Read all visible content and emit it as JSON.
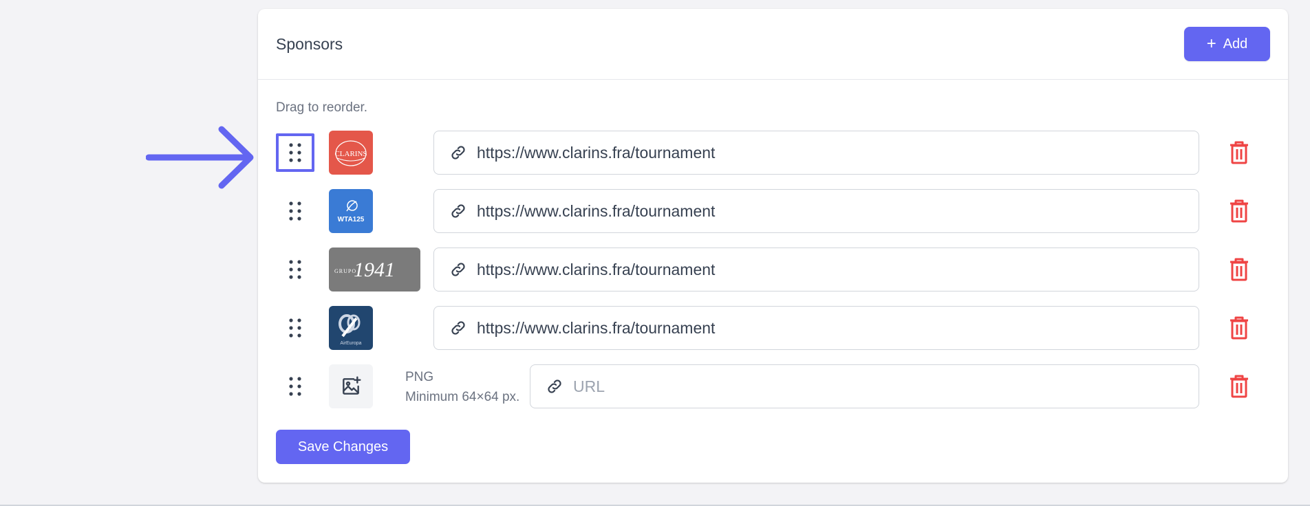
{
  "sponsors": {
    "title": "Sponsors",
    "add_label": "Add",
    "hint": "Drag to reorder.",
    "save_label": "Save Changes",
    "rows": [
      {
        "logo": "clarins",
        "logo_text": "CLARINS",
        "url": "https://www.clarins.fra/tournament"
      },
      {
        "logo": "wta",
        "logo_text": "WTA125",
        "url": "https://www.clarins.fra/tournament"
      },
      {
        "logo": "grupo",
        "logo_text_small": "GRUPO",
        "logo_text": "1941",
        "url": "https://www.clarins.fra/tournament"
      },
      {
        "logo": "aireuropa",
        "logo_text": "AirEuropa",
        "url": "https://www.clarins.fra/tournament"
      }
    ],
    "upload_row": {
      "format": "PNG",
      "requirement": "Minimum 64×64 px.",
      "url_placeholder": "URL"
    }
  },
  "colors": {
    "accent": "#6366f1",
    "danger": "#ef4444",
    "clarins": "#e4574a",
    "wta": "#3a7bd5",
    "grupo": "#7b7b7b",
    "aireuropa": "#21466f"
  }
}
